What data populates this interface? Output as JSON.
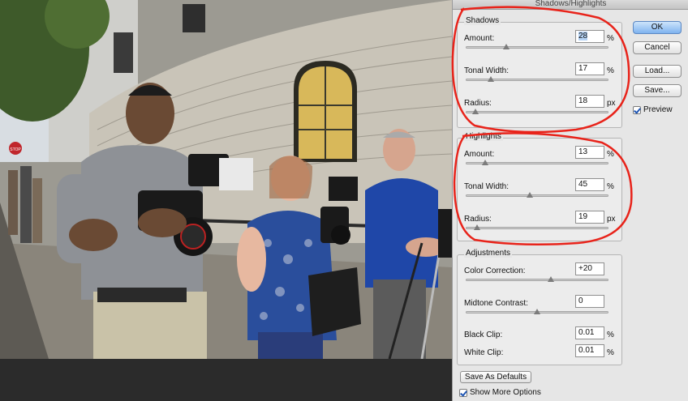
{
  "dialog": {
    "title": "Shadows/Highlights",
    "buttons": {
      "ok": "OK",
      "cancel": "Cancel",
      "load": "Load...",
      "save": "Save..."
    },
    "preview": {
      "label": "Preview",
      "checked": true
    }
  },
  "shadows": {
    "title": "Shadows",
    "amount": {
      "label": "Amount:",
      "value": "28",
      "unit": "%",
      "fraction": 0.28
    },
    "tonal_width": {
      "label": "Tonal Width:",
      "value": "17",
      "unit": "%",
      "fraction": 0.17
    },
    "radius": {
      "label": "Radius:",
      "value": "18",
      "unit": "px",
      "fraction": 0.06
    }
  },
  "highlights": {
    "title": "Highlights",
    "amount": {
      "label": "Amount:",
      "value": "13",
      "unit": "%",
      "fraction": 0.13
    },
    "tonal_width": {
      "label": "Tonal Width:",
      "value": "45",
      "unit": "%",
      "fraction": 0.45
    },
    "radius": {
      "label": "Radius:",
      "value": "19",
      "unit": "px",
      "fraction": 0.07
    }
  },
  "adjustments": {
    "title": "Adjustments",
    "color_correction": {
      "label": "Color Correction:",
      "value": "+20",
      "fraction": 0.6
    },
    "midtone_contrast": {
      "label": "Midtone Contrast:",
      "value": "0",
      "fraction": 0.5
    },
    "black_clip": {
      "label": "Black Clip:",
      "value": "0.01",
      "unit": "%"
    },
    "white_clip": {
      "label": "White Clip:",
      "value": "0.01",
      "unit": "%"
    }
  },
  "footer": {
    "save_defaults": "Save As Defaults",
    "show_more": {
      "label": "Show More Options",
      "checked": true
    }
  },
  "photo": {
    "stop_sign": "STOP"
  },
  "colors": {
    "annotation": "#e8231a",
    "primary_button": "#7fb3ef"
  }
}
